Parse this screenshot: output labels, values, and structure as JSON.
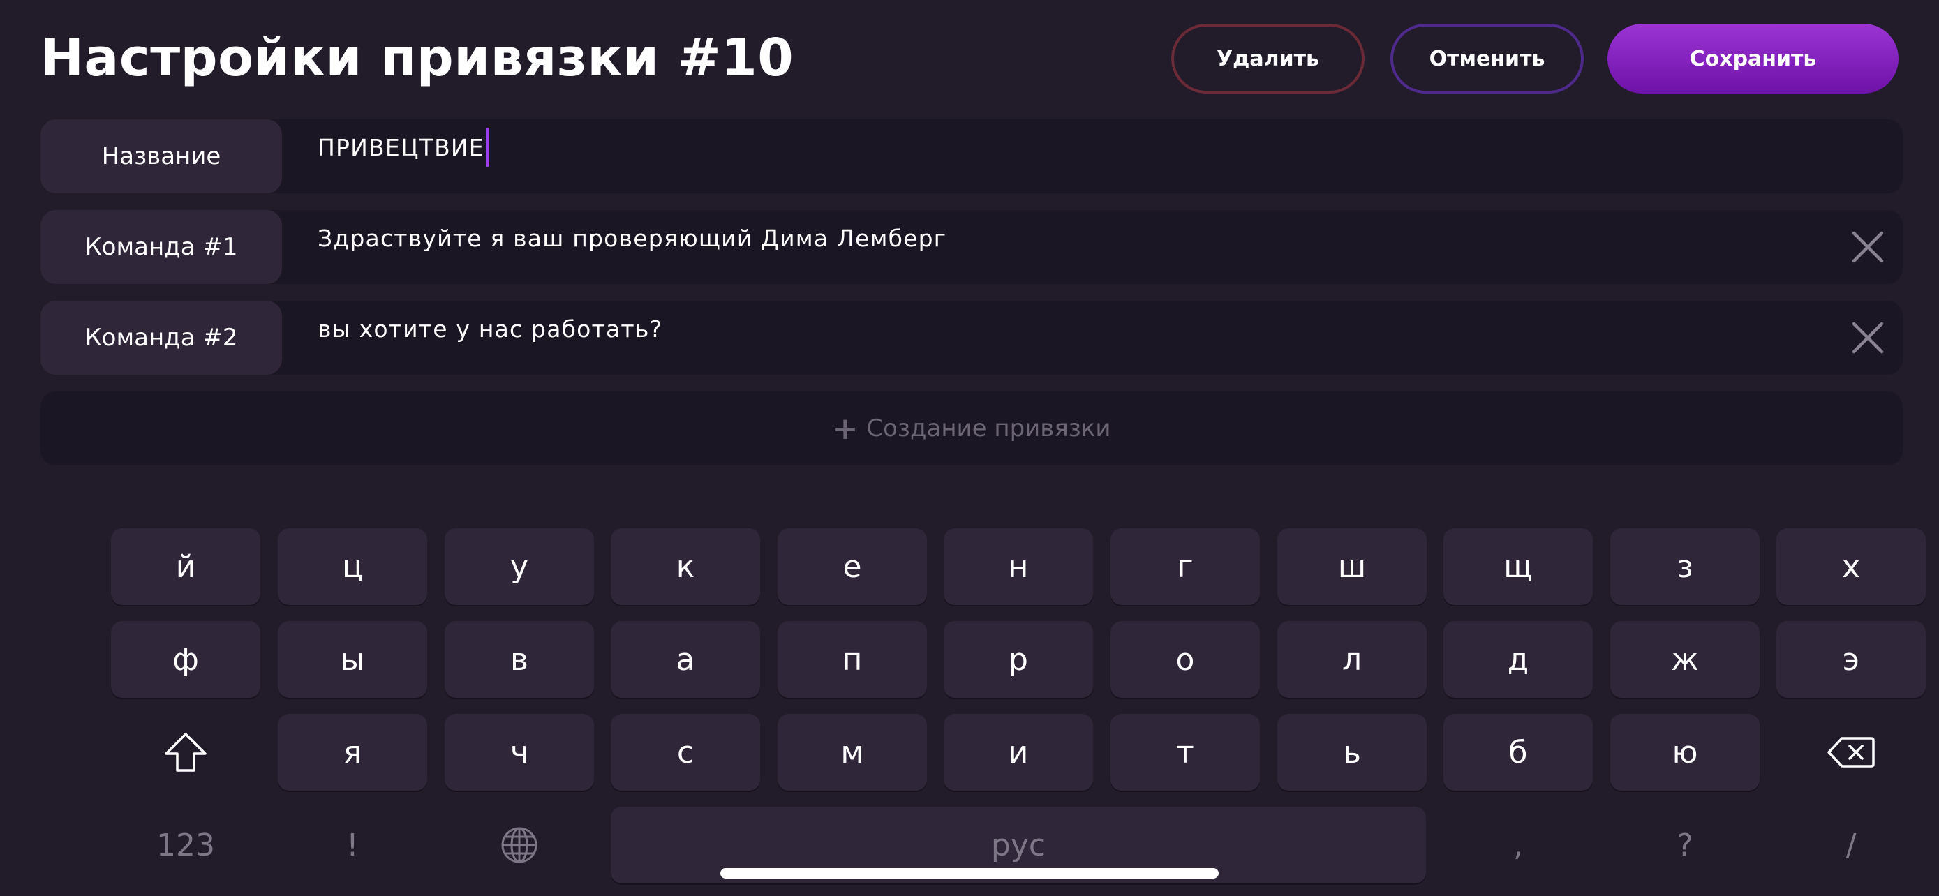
{
  "header": {
    "title": "Настройки привязки #10",
    "delete_label": "Удалить",
    "cancel_label": "Отменить",
    "save_label": "Сохранить"
  },
  "fields": {
    "name_label": "Название",
    "name_value": "ПРИВЕЦТВИЕ",
    "command1_label": "Команда #1",
    "command1_value": "Здраствуйте я ваш проверяющий Дима Лемберг",
    "command2_label": "Команда #2",
    "command2_value": "вы хотите у нас работать?",
    "add_binding_label": "Создание привязки"
  },
  "keyboard": {
    "row1": [
      "й",
      "ц",
      "у",
      "к",
      "е",
      "н",
      "г",
      "ш",
      "щ",
      "з",
      "х"
    ],
    "row2": [
      "ф",
      "ы",
      "в",
      "а",
      "п",
      "р",
      "о",
      "л",
      "д",
      "ж",
      "э"
    ],
    "row3": [
      "я",
      "ч",
      "с",
      "м",
      "и",
      "т",
      "ь",
      "б",
      "ю"
    ],
    "numbers_key": "123",
    "exclamation_key": "!",
    "space_key": "рус",
    "comma_key": ",",
    "question_key": "?",
    "slash_key": "/",
    "icons": [
      "shift-icon",
      "globe-icon",
      "backspace-icon"
    ]
  },
  "colors": {
    "background": "#211b2a",
    "key": "#2f2639",
    "accent": "#8d28c8",
    "delete_border": "#6b2a36",
    "cancel_border": "#4f2a8c"
  }
}
